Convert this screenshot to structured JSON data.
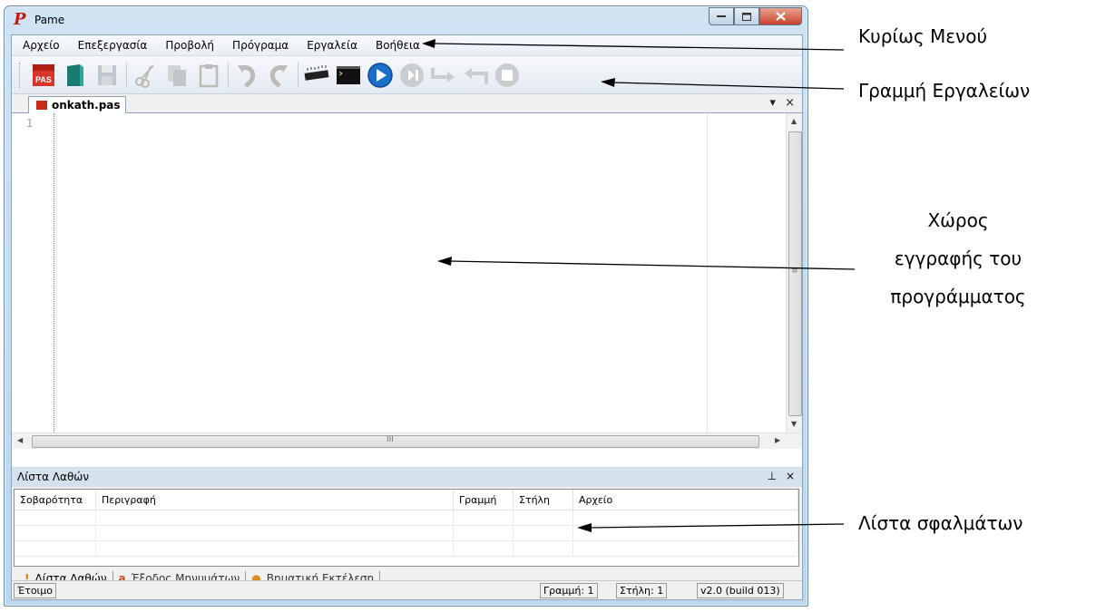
{
  "window": {
    "title": "Pame",
    "logo": "P"
  },
  "menu": [
    "Αρχείο",
    "Επεξεργασία",
    "Προβολή",
    "Πρόγραμα",
    "Εργαλεία",
    "Βοήθεια"
  ],
  "toolbar": {
    "new_badge": "PAS"
  },
  "doc_tab": {
    "label": "onkath.pas",
    "menu_glyph": "▾",
    "close_glyph": "×"
  },
  "editor": {
    "line_number": "1",
    "hscroll_grip": "III",
    "vscroll_grip": "≡"
  },
  "error_panel": {
    "title": "Λίστα Λαθών",
    "pin_glyph": "⊥",
    "close_glyph": "×",
    "columns": [
      "Σοβαρότητα",
      "Περιγραφή",
      "Γραμμή",
      "Στήλη",
      "Αρχείο"
    ]
  },
  "bottom_tabs": [
    {
      "icon": "!",
      "label": "Λίστα Λαθών"
    },
    {
      "icon": "a",
      "label": "Έξοδος Μηνυμάτων"
    },
    {
      "icon": "●",
      "label": "Βηματική Εκτέλεση"
    }
  ],
  "status": {
    "ready": "Έτοιμο",
    "line": "Γραμμή: 1",
    "column": "Στήλη: 1",
    "version": "v2.0 (build 013)"
  },
  "callouts": {
    "main_menu": "Κυρίως Μενού",
    "toolbar": "Γραμμή Εργαλείων",
    "editor_line1": "Χώρος",
    "editor_line2": "εγγραφής του",
    "editor_line3": "προγράμματος",
    "errors": "Λίστα σφαλμάτων"
  },
  "colors": {
    "accent_run": "#1a6fc9",
    "logo_red": "#c8160e"
  }
}
